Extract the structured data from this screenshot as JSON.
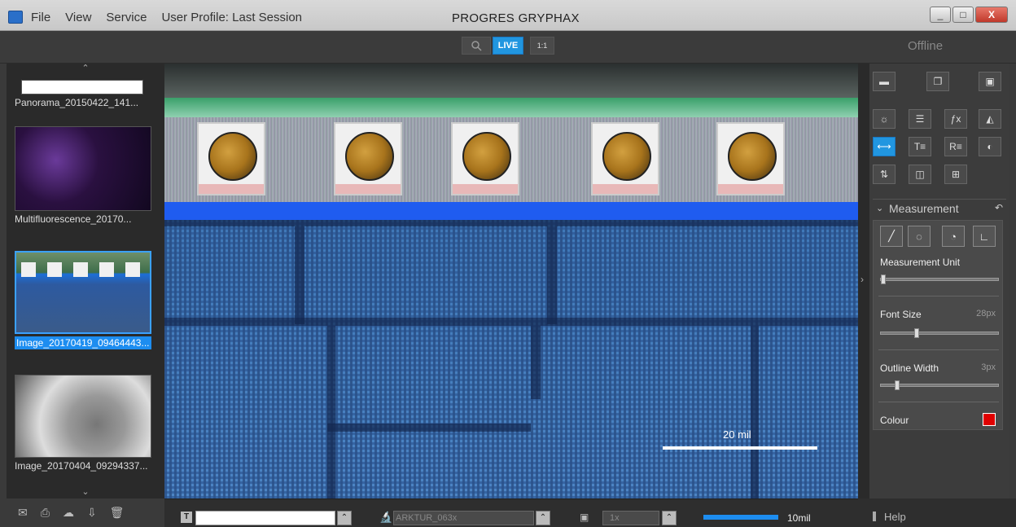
{
  "window": {
    "title": "PROGRES GRYPHAX",
    "menu": [
      "File",
      "View",
      "Service",
      "User Profile: Last Session"
    ],
    "minimize": "_",
    "maximize": "□",
    "close": "X"
  },
  "toolbar": {
    "live_label": "LIVE",
    "one_to_one_label": "1:1",
    "status": "Offline"
  },
  "thumbnails": [
    {
      "caption": "Panorama_20150422_141...",
      "selected": false
    },
    {
      "caption": "Multifluorescence_20170...",
      "selected": false
    },
    {
      "caption": "Image_20170419_09464443...",
      "selected": true
    },
    {
      "caption": "Image_20170404_09294337...",
      "selected": false
    }
  ],
  "viewer": {
    "scale_label": "20 mil"
  },
  "bottom": {
    "text_tool": "T",
    "objective": "ARKTUR_063x",
    "zoom": "1x",
    "scale_value": "10mil"
  },
  "right": {
    "section_title": "Measurement",
    "measurement_unit_label": "Measurement Unit",
    "font_size_label": "Font Size",
    "font_size_value": "28px",
    "outline_width_label": "Outline Width",
    "outline_width_value": "3px",
    "colour_label": "Colour",
    "colour": "#e00000",
    "help_label": "Help"
  },
  "colors": {
    "accent": "#2196e0",
    "selection": "#1d8df0"
  },
  "slider_levels": {
    "measurement_unit": 0.0,
    "font_size": 0.3,
    "outline_width": 0.12
  }
}
